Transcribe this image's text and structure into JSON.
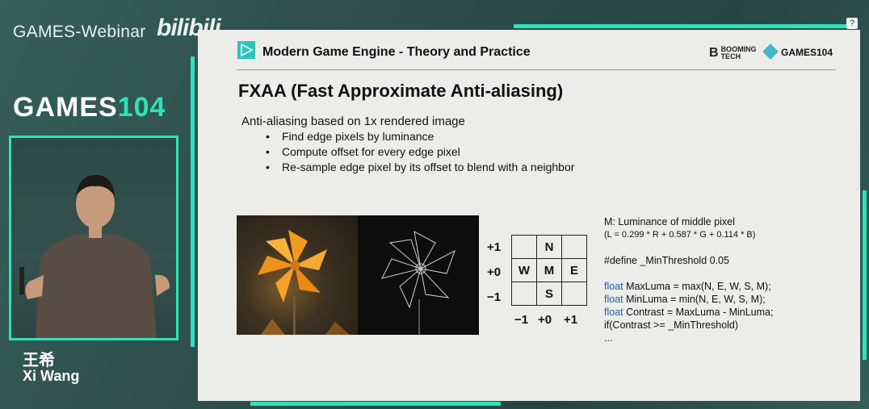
{
  "stream": {
    "brand": "GAMES-Webinar",
    "platform": "bilibili",
    "games_logo_text": "GAMES",
    "games_logo_num": "104",
    "speaker_cn": "王希",
    "speaker_en": "Xi Wang",
    "help_label": "?"
  },
  "slide": {
    "course_title": "Modern Game Engine - Theory and Practice",
    "logo_booming": "BOOMING TECH",
    "logo_games": "GAMES104",
    "title": "FXAA (Fast Approximate Anti-aliasing)",
    "intro": "Anti-aliasing based on 1x rendered image",
    "bullets": [
      "Find edge pixels by luminance",
      "Compute offset for every edge pixel",
      "Re-sample edge pixel by its offset to blend with a neighbor"
    ],
    "grid": {
      "cells": [
        [
          "",
          "N",
          ""
        ],
        [
          "W",
          "M",
          "E"
        ],
        [
          "",
          "S",
          ""
        ]
      ],
      "row_labels": [
        "+1",
        "+0",
        "−1"
      ],
      "col_labels": [
        "−1",
        "+0",
        "+1"
      ]
    },
    "code": {
      "line1": "M: Luminance of middle pixel",
      "line2": "(L = 0.299 * R + 0.587 * G + 0.114 * B)",
      "line3": "#define _MinThreshold 0.05",
      "kw": "float",
      "line4_rest": " MaxLuma = max(N, E, W, S, M);",
      "line5_rest": " MinLuma = min(N, E, W, S, M);",
      "line6_rest": " Contrast =  MaxLuma - MinLuma;",
      "line7": "if(Contrast >= _MinThreshold)",
      "line8": "..."
    }
  },
  "colors": {
    "accent": "#2de3b8",
    "slide_bg": "#ecece9",
    "keyword": "#2a5ea8"
  }
}
